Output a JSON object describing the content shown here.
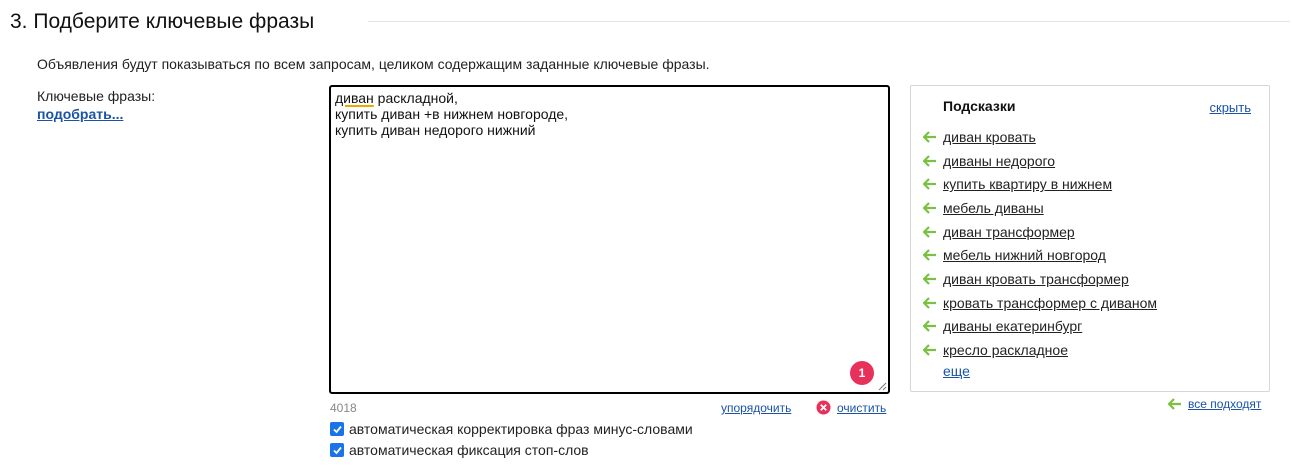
{
  "section": {
    "title": "3. Подберите ключевые фразы",
    "description": "Объявления будут показываться по всем запросам, целиком содержащим заданные ключевые фразы."
  },
  "keywords": {
    "label": "Ключевые фразы:",
    "pick_link": "подобрать...",
    "lines": {
      "line1_word": "диван",
      "line1_rest": " раскладной,",
      "line2": "купить диван +в нижнем новгороде,",
      "line3": "купить диван недорого нижний"
    },
    "badge": "1",
    "counter": "4018",
    "sort_link": "упорядочить",
    "clear_link": "очистить",
    "options": {
      "minus_words": "автоматическая корректировка фраз минус-словами",
      "stop_words": "автоматическая фиксация стоп-слов"
    }
  },
  "hints": {
    "title": "Подсказки",
    "hide_link": "скрыть",
    "items": [
      "диван кровать",
      "диваны недорого",
      "купить квартиру в нижнем",
      "мебель диваны",
      "диван трансформер",
      "мебель нижний новгород",
      "диван кровать трансформер",
      "кровать трансформер с диваном",
      "диваны екатеринбург",
      "кресло раскладное"
    ],
    "more_link": "еще",
    "all_fit_link": "все подходят"
  },
  "colors": {
    "link": "#1a53a7",
    "arrow": "#7bc043",
    "badge": "#e8315a",
    "checkbox": "#1a73e8",
    "clear_icon": "#e8315a"
  },
  "icons": {
    "hint_arrow": "arrow-left-icon",
    "clear": "clear-icon",
    "checkbox": "checkbox-checked-icon",
    "resize": "resize-grip-icon"
  }
}
